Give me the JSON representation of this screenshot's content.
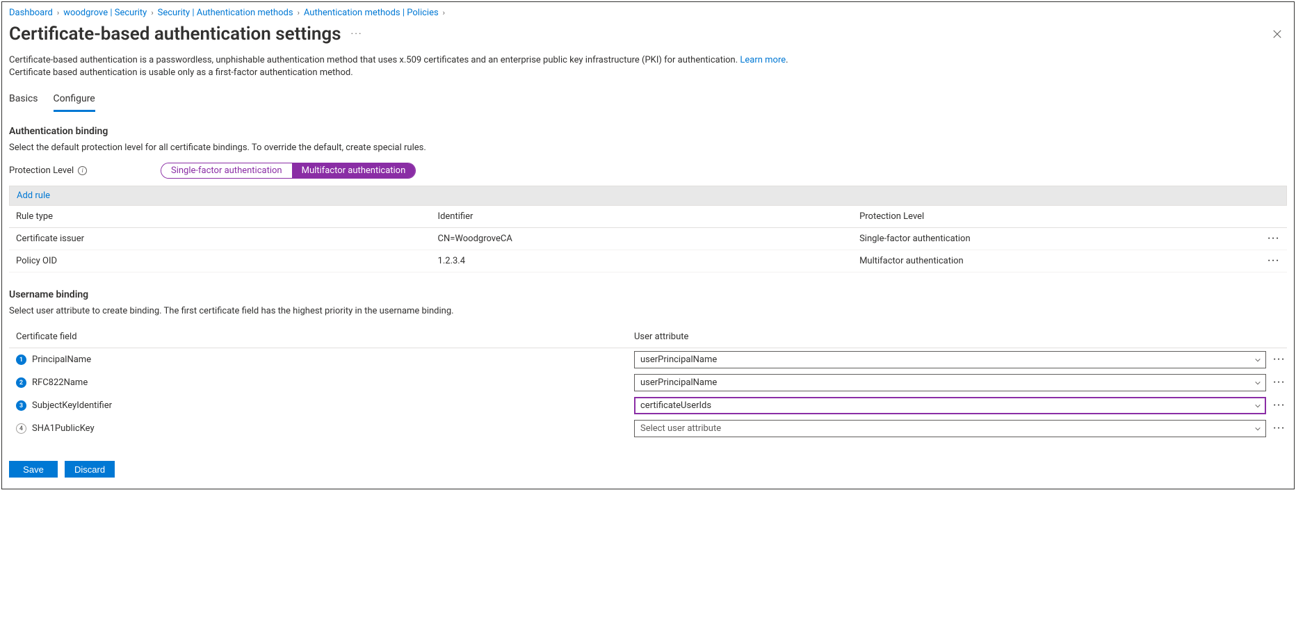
{
  "breadcrumb": [
    "Dashboard",
    "woodgrove | Security",
    "Security | Authentication methods",
    "Authentication methods | Policies"
  ],
  "title": "Certificate-based authentication settings",
  "description_1": "Certificate-based authentication is a passwordless, unphishable authentication method that uses x.509 certificates and an enterprise public key infrastructure (PKI) for authentication. ",
  "learn_more": "Learn more",
  "description_2": "Certificate based authentication is usable only as a first-factor authentication method.",
  "tabs": {
    "basics": "Basics",
    "configure": "Configure"
  },
  "auth_binding": {
    "heading": "Authentication binding",
    "desc": "Select the default protection level for all certificate bindings. To override the default, create special rules.",
    "label": "Protection Level",
    "pill_single": "Single-factor authentication",
    "pill_multi": "Multifactor authentication",
    "add_rule": "Add rule",
    "headers": {
      "type": "Rule type",
      "identifier": "Identifier",
      "level": "Protection Level"
    },
    "rows": [
      {
        "type": "Certificate issuer",
        "identifier": "CN=WoodgroveCA",
        "level": "Single-factor authentication"
      },
      {
        "type": "Policy OID",
        "identifier": "1.2.3.4",
        "level": "Multifactor authentication"
      }
    ]
  },
  "user_binding": {
    "heading": "Username binding",
    "desc": "Select user attribute to create binding. The first certificate field has the highest priority in the username binding.",
    "headers": {
      "cert": "Certificate field",
      "attr": "User attribute"
    },
    "placeholder": "Select user attribute",
    "rows": [
      {
        "num": "1",
        "cert": "PrincipalName",
        "attr": "userPrincipalName",
        "filled": true,
        "focused": false
      },
      {
        "num": "2",
        "cert": "RFC822Name",
        "attr": "userPrincipalName",
        "filled": true,
        "focused": false
      },
      {
        "num": "3",
        "cert": "SubjectKeyIdentifier",
        "attr": "certificateUserIds",
        "filled": true,
        "focused": true
      },
      {
        "num": "4",
        "cert": "SHA1PublicKey",
        "attr": "",
        "filled": false,
        "focused": false
      }
    ]
  },
  "footer": {
    "save": "Save",
    "discard": "Discard"
  }
}
